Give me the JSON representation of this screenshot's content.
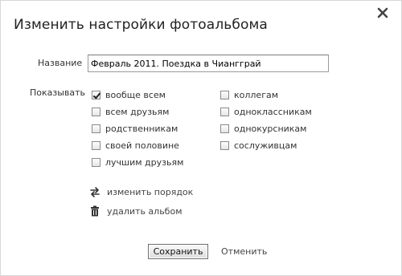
{
  "dialog": {
    "title": "Изменить настройки фотоальбома",
    "close_icon": "close-icon"
  },
  "form": {
    "name_label": "Название",
    "name_value": "Февраль 2011. Поездка в Чиангграй",
    "show_label": "Показывать"
  },
  "visibility": {
    "left": [
      {
        "label": "вообще всем",
        "checked": true
      },
      {
        "label": "всем друзьям",
        "checked": false
      },
      {
        "label": "родственникам",
        "checked": false
      },
      {
        "label": "своей половине",
        "checked": false
      },
      {
        "label": "лучшим друзьям",
        "checked": false
      }
    ],
    "right": [
      {
        "label": "коллегам",
        "checked": false
      },
      {
        "label": "одноклассникам",
        "checked": false
      },
      {
        "label": "однокурсникам",
        "checked": false
      },
      {
        "label": "сослуживцам",
        "checked": false
      }
    ]
  },
  "actions": {
    "reorder_label": "изменить порядок",
    "reorder_icon": "swap-arrows-icon",
    "delete_label": "удалить альбом",
    "delete_icon": "trash-icon"
  },
  "buttons": {
    "save_label": "Сохранить",
    "cancel_label": "Отменить"
  }
}
